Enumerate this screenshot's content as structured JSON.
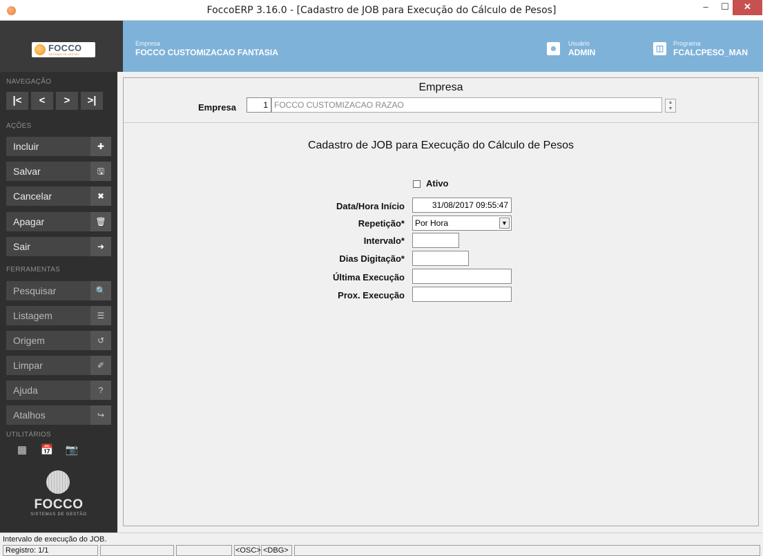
{
  "window": {
    "title": "FoccoERP 3.16.0 - [Cadastro de JOB para Execução do Cálculo de Pesos]",
    "min_glyph": "–",
    "max_glyph": "☐",
    "close_glyph": "✕"
  },
  "header": {
    "logo_text": "FOCCO",
    "logo_sub": "SISTEMAS DE GESTÃO",
    "empresa_small": "Empresa",
    "empresa_value": "FOCCO CUSTOMIZACAO FANTASIA",
    "usuario_small": "Usuário",
    "usuario_value": "ADMIN",
    "programa_small": "Programa",
    "programa_value": "FCALCPESO_MAN"
  },
  "sidebar": {
    "nav_title": "NAVEGAÇÃO",
    "nav_buttons": [
      "|<",
      "<",
      ">",
      ">|"
    ],
    "actions_title": "AÇÕES",
    "actions": [
      {
        "label": "Incluir",
        "icon": "✚"
      },
      {
        "label": "Salvar",
        "icon": "🖫"
      },
      {
        "label": "Cancelar",
        "icon": "✖"
      },
      {
        "label": "Apagar",
        "icon": "🗑"
      },
      {
        "label": "Sair",
        "icon": "➜"
      }
    ],
    "tools_title": "FERRAMENTAS",
    "tools": [
      {
        "label": "Pesquisar",
        "icon": "🔍"
      },
      {
        "label": "Listagem",
        "icon": "☰"
      },
      {
        "label": "Origem",
        "icon": "↺"
      },
      {
        "label": "Limpar",
        "icon": "✐"
      },
      {
        "label": "Ajuda",
        "icon": "?"
      },
      {
        "label": "Atalhos",
        "icon": "↪"
      }
    ],
    "utils_title": "UTILITÁRIOS",
    "utils_icons": [
      "▦",
      "📅",
      "📷"
    ],
    "footer_logo": "FOCCO",
    "footer_sub": "SISTEMAS DE GESTÃO"
  },
  "main": {
    "empresa_section_title": "Empresa",
    "empresa_label": "Empresa",
    "empresa_code": "1",
    "empresa_name": "FOCCO CUSTOMIZACAO RAZAO",
    "form_title": "Cadastro de JOB para Execução do Cálculo de Pesos",
    "ativo_label": "Ativo",
    "ativo_checked": false,
    "fields": {
      "data_hora_label": "Data/Hora Início",
      "data_hora_value": "31/08/2017 09:55:47",
      "repeticao_label": "Repetição*",
      "repeticao_value": "Por Hora",
      "intervalo_label": "Intervalo*",
      "intervalo_value": "",
      "dias_label": "Dias Digitação*",
      "dias_value": "",
      "ultima_label": "Última Execução",
      "ultima_value": "",
      "prox_label": "Prox. Execução",
      "prox_value": ""
    }
  },
  "status": {
    "message": "Intervalo de execução do JOB.",
    "registro": "Registro: 1/1",
    "osc": "<OSC>",
    "dbg": "<DBG>"
  }
}
